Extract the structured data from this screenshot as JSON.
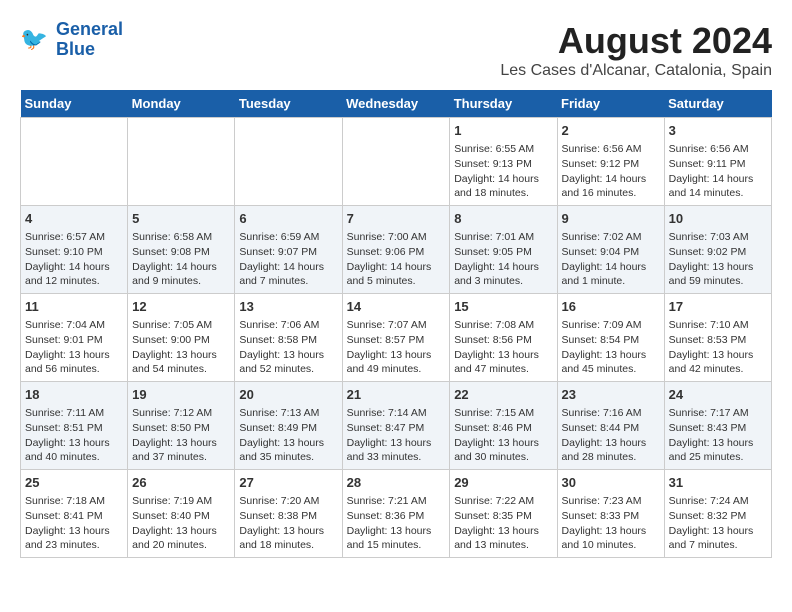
{
  "header": {
    "logo_line1": "General",
    "logo_line2": "Blue",
    "month": "August 2024",
    "location": "Les Cases d'Alcanar, Catalonia, Spain"
  },
  "weekdays": [
    "Sunday",
    "Monday",
    "Tuesday",
    "Wednesday",
    "Thursday",
    "Friday",
    "Saturday"
  ],
  "weeks": [
    [
      {
        "day": "",
        "content": ""
      },
      {
        "day": "",
        "content": ""
      },
      {
        "day": "",
        "content": ""
      },
      {
        "day": "",
        "content": ""
      },
      {
        "day": "1",
        "content": "Sunrise: 6:55 AM\nSunset: 9:13 PM\nDaylight: 14 hours\nand 18 minutes."
      },
      {
        "day": "2",
        "content": "Sunrise: 6:56 AM\nSunset: 9:12 PM\nDaylight: 14 hours\nand 16 minutes."
      },
      {
        "day": "3",
        "content": "Sunrise: 6:56 AM\nSunset: 9:11 PM\nDaylight: 14 hours\nand 14 minutes."
      }
    ],
    [
      {
        "day": "4",
        "content": "Sunrise: 6:57 AM\nSunset: 9:10 PM\nDaylight: 14 hours\nand 12 minutes."
      },
      {
        "day": "5",
        "content": "Sunrise: 6:58 AM\nSunset: 9:08 PM\nDaylight: 14 hours\nand 9 minutes."
      },
      {
        "day": "6",
        "content": "Sunrise: 6:59 AM\nSunset: 9:07 PM\nDaylight: 14 hours\nand 7 minutes."
      },
      {
        "day": "7",
        "content": "Sunrise: 7:00 AM\nSunset: 9:06 PM\nDaylight: 14 hours\nand 5 minutes."
      },
      {
        "day": "8",
        "content": "Sunrise: 7:01 AM\nSunset: 9:05 PM\nDaylight: 14 hours\nand 3 minutes."
      },
      {
        "day": "9",
        "content": "Sunrise: 7:02 AM\nSunset: 9:04 PM\nDaylight: 14 hours\nand 1 minute."
      },
      {
        "day": "10",
        "content": "Sunrise: 7:03 AM\nSunset: 9:02 PM\nDaylight: 13 hours\nand 59 minutes."
      }
    ],
    [
      {
        "day": "11",
        "content": "Sunrise: 7:04 AM\nSunset: 9:01 PM\nDaylight: 13 hours\nand 56 minutes."
      },
      {
        "day": "12",
        "content": "Sunrise: 7:05 AM\nSunset: 9:00 PM\nDaylight: 13 hours\nand 54 minutes."
      },
      {
        "day": "13",
        "content": "Sunrise: 7:06 AM\nSunset: 8:58 PM\nDaylight: 13 hours\nand 52 minutes."
      },
      {
        "day": "14",
        "content": "Sunrise: 7:07 AM\nSunset: 8:57 PM\nDaylight: 13 hours\nand 49 minutes."
      },
      {
        "day": "15",
        "content": "Sunrise: 7:08 AM\nSunset: 8:56 PM\nDaylight: 13 hours\nand 47 minutes."
      },
      {
        "day": "16",
        "content": "Sunrise: 7:09 AM\nSunset: 8:54 PM\nDaylight: 13 hours\nand 45 minutes."
      },
      {
        "day": "17",
        "content": "Sunrise: 7:10 AM\nSunset: 8:53 PM\nDaylight: 13 hours\nand 42 minutes."
      }
    ],
    [
      {
        "day": "18",
        "content": "Sunrise: 7:11 AM\nSunset: 8:51 PM\nDaylight: 13 hours\nand 40 minutes."
      },
      {
        "day": "19",
        "content": "Sunrise: 7:12 AM\nSunset: 8:50 PM\nDaylight: 13 hours\nand 37 minutes."
      },
      {
        "day": "20",
        "content": "Sunrise: 7:13 AM\nSunset: 8:49 PM\nDaylight: 13 hours\nand 35 minutes."
      },
      {
        "day": "21",
        "content": "Sunrise: 7:14 AM\nSunset: 8:47 PM\nDaylight: 13 hours\nand 33 minutes."
      },
      {
        "day": "22",
        "content": "Sunrise: 7:15 AM\nSunset: 8:46 PM\nDaylight: 13 hours\nand 30 minutes."
      },
      {
        "day": "23",
        "content": "Sunrise: 7:16 AM\nSunset: 8:44 PM\nDaylight: 13 hours\nand 28 minutes."
      },
      {
        "day": "24",
        "content": "Sunrise: 7:17 AM\nSunset: 8:43 PM\nDaylight: 13 hours\nand 25 minutes."
      }
    ],
    [
      {
        "day": "25",
        "content": "Sunrise: 7:18 AM\nSunset: 8:41 PM\nDaylight: 13 hours\nand 23 minutes."
      },
      {
        "day": "26",
        "content": "Sunrise: 7:19 AM\nSunset: 8:40 PM\nDaylight: 13 hours\nand 20 minutes."
      },
      {
        "day": "27",
        "content": "Sunrise: 7:20 AM\nSunset: 8:38 PM\nDaylight: 13 hours\nand 18 minutes."
      },
      {
        "day": "28",
        "content": "Sunrise: 7:21 AM\nSunset: 8:36 PM\nDaylight: 13 hours\nand 15 minutes."
      },
      {
        "day": "29",
        "content": "Sunrise: 7:22 AM\nSunset: 8:35 PM\nDaylight: 13 hours\nand 13 minutes."
      },
      {
        "day": "30",
        "content": "Sunrise: 7:23 AM\nSunset: 8:33 PM\nDaylight: 13 hours\nand 10 minutes."
      },
      {
        "day": "31",
        "content": "Sunrise: 7:24 AM\nSunset: 8:32 PM\nDaylight: 13 hours\nand 7 minutes."
      }
    ]
  ]
}
